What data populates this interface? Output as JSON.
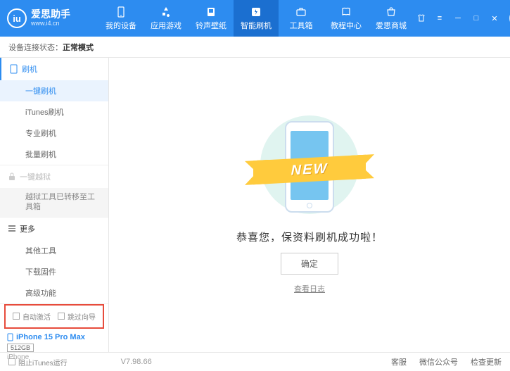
{
  "header": {
    "logo_title": "爱思助手",
    "logo_url": "www.i4.cn",
    "nav": [
      {
        "label": "我的设备"
      },
      {
        "label": "应用游戏"
      },
      {
        "label": "铃声壁纸"
      },
      {
        "label": "智能刷机"
      },
      {
        "label": "工具箱"
      },
      {
        "label": "教程中心"
      },
      {
        "label": "爱思商城"
      }
    ]
  },
  "status": {
    "label": "设备连接状态：",
    "value": "正常模式"
  },
  "sidebar": {
    "flash_header": "刷机",
    "flash_items": [
      "一键刷机",
      "iTunes刷机",
      "专业刷机",
      "批量刷机"
    ],
    "jailbreak_header": "一键越狱",
    "jailbreak_note": "越狱工具已转移至工具箱",
    "more_header": "更多",
    "more_items": [
      "其他工具",
      "下载固件",
      "高级功能"
    ],
    "auto_activate": "自动激活",
    "skip_guide": "跳过向导",
    "device_name": "iPhone 15 Pro Max",
    "device_storage": "512GB",
    "device_type": "iPhone"
  },
  "main": {
    "ribbon": "NEW",
    "success": "恭喜您，保资料刷机成功啦！",
    "ok": "确定",
    "log": "查看日志"
  },
  "footer": {
    "block_itunes": "阻止iTunes运行",
    "version": "V7.98.66",
    "links": [
      "客服",
      "微信公众号",
      "检查更新"
    ]
  }
}
